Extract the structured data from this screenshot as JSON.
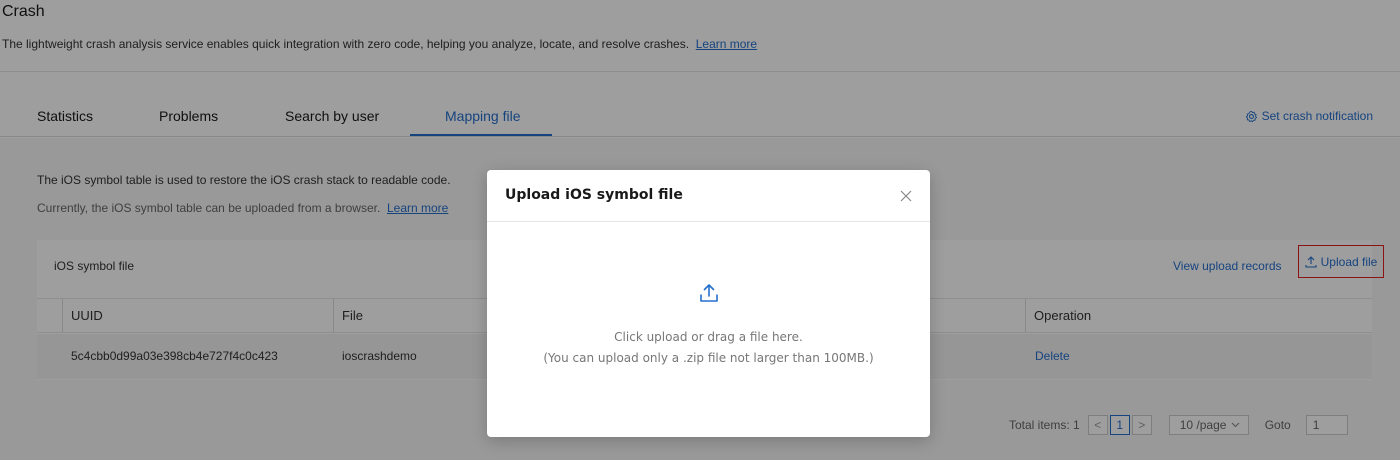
{
  "page": {
    "title": "Crash",
    "description": "The lightweight crash analysis service enables quick integration with zero code, helping you analyze, locate, and resolve crashes.",
    "learn_more": "Learn more"
  },
  "tabs": [
    {
      "label": "Statistics",
      "active": false
    },
    {
      "label": "Problems",
      "active": false
    },
    {
      "label": "Search by user",
      "active": false
    },
    {
      "label": "Mapping file",
      "active": true
    }
  ],
  "notification": {
    "label": "Set crash notification",
    "icon": "gear-icon"
  },
  "info": {
    "line1": "The iOS symbol table is used to restore the iOS crash stack to readable code.",
    "line2": "Currently, the iOS symbol table can be uploaded from a browser.",
    "learn_more": "Learn more"
  },
  "card": {
    "title": "iOS symbol file",
    "view_records": "View upload records",
    "upload_button": "Upload file",
    "columns": [
      "UUID",
      "File",
      "Operation"
    ],
    "rows": [
      {
        "uuid": "5c4cbb0d99a03e398cb4e727f4c0c423",
        "file": "ioscrashdemo",
        "operation": "Delete"
      }
    ]
  },
  "pagination": {
    "total_label": "Total items: 1",
    "prev": "<",
    "current_page": "1",
    "next": ">",
    "page_size": "10 /page",
    "goto_label": "Goto",
    "goto_value": "1"
  },
  "modal": {
    "title": "Upload iOS symbol file",
    "hint_line1": "Click upload or drag a file here.",
    "hint_line2": "(You can upload only a .zip file not larger than 100MB.)"
  },
  "colors": {
    "accent": "#256fce",
    "highlight_border": "#e02020"
  }
}
